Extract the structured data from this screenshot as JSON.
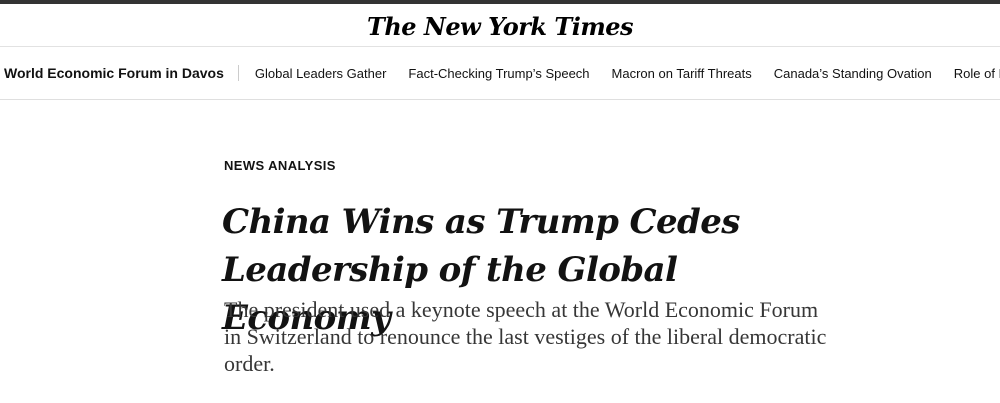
{
  "masthead": {
    "logo_text": "The New York Times"
  },
  "subnav": {
    "section_title": "World Economic Forum in Davos",
    "links": [
      "Global Leaders Gather",
      "Fact-Checking Trump’s Speech",
      "Macron on Tariff Threats",
      "Canada’s Standing Ovation",
      "Role of B"
    ]
  },
  "article": {
    "kicker": "NEWS ANALYSIS",
    "headline": "China Wins as Trump Cedes Leadership of the Global Economy",
    "summary": "The president used a keynote speech at the World Economic Forum in Switzerland to renounce the last vestiges of the liberal democratic order."
  },
  "colors": {
    "top_rule": "#333333",
    "text": "#121212",
    "summary_text": "#363636",
    "divider": "#dfdfdf"
  }
}
